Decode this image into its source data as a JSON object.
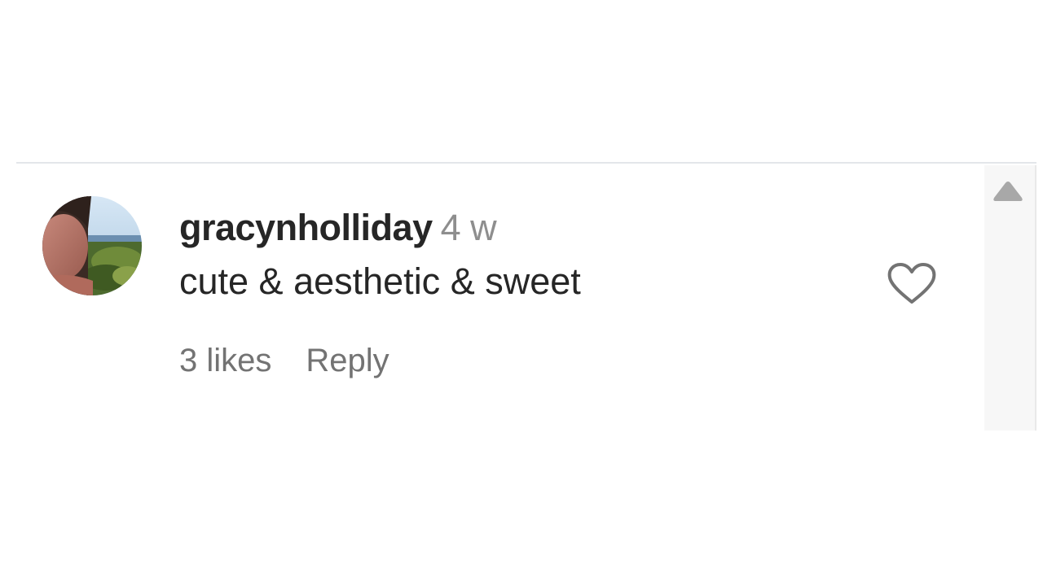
{
  "comment": {
    "username": "gracynholliday",
    "time_ago": "4 w",
    "text": "cute & aesthetic & sweet",
    "likes_label": "3 likes",
    "reply_label": "Reply",
    "avatar_icon": "profile-photo",
    "like_icon": "heart-outline-icon"
  },
  "scrollbar": {
    "up_icon": "scroll-up-arrow-icon"
  },
  "colors": {
    "primary_text": "#262626",
    "secondary_text": "#8e8e8e",
    "meta_text": "#737373",
    "divider": "#e3e6ea",
    "scrollbar_track": "#f7f7f7",
    "scroll_arrow": "#a8a8a8"
  }
}
